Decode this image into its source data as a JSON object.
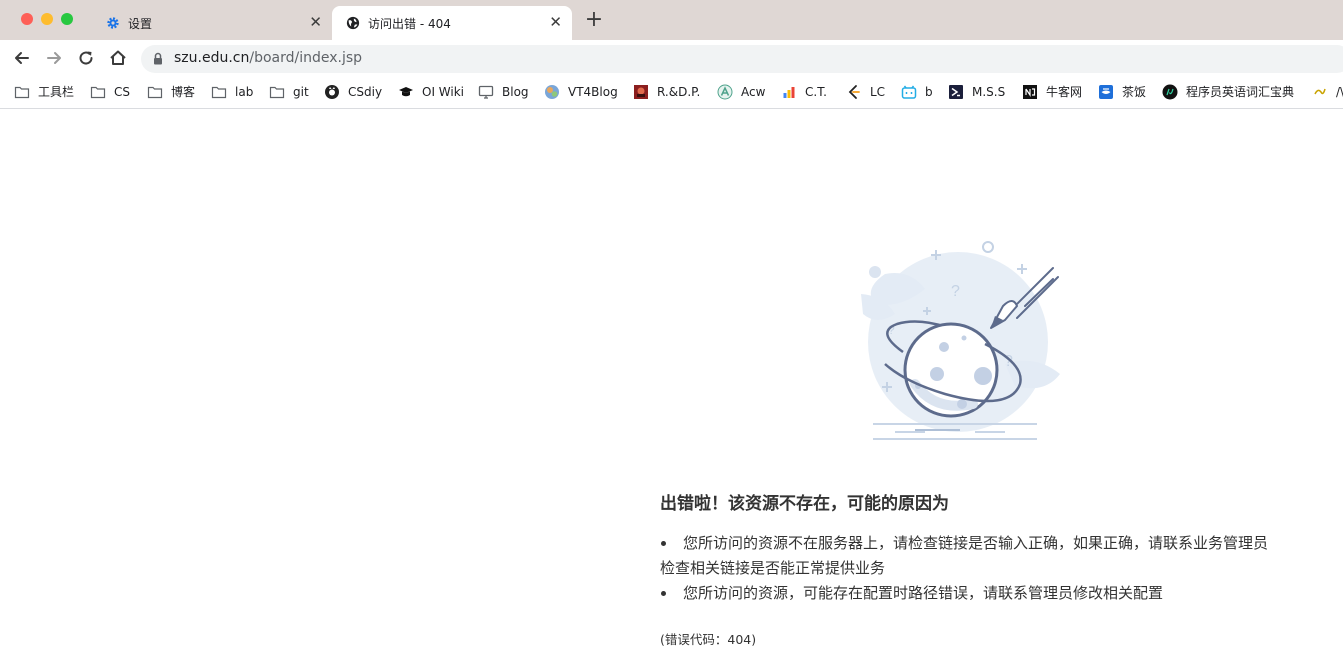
{
  "browser": {
    "tabs": [
      {
        "title": "设置",
        "icon": "gear-icon",
        "active": false
      },
      {
        "title": "访问出错 - 404",
        "icon": "globe-icon",
        "active": true
      }
    ],
    "url": {
      "host": "szu.edu.cn",
      "path": "/board/index.jsp"
    },
    "bookmarks": [
      {
        "label": "工具栏",
        "icon": "folder-icon"
      },
      {
        "label": "CS",
        "icon": "folder-icon"
      },
      {
        "label": "博客",
        "icon": "folder-icon"
      },
      {
        "label": "lab",
        "icon": "folder-icon"
      },
      {
        "label": "git",
        "icon": "folder-icon"
      },
      {
        "label": "CSdiy",
        "icon": "csdiy-icon"
      },
      {
        "label": "OI Wiki",
        "icon": "graduation-cap-icon"
      },
      {
        "label": "Blog",
        "icon": "monitor-icon"
      },
      {
        "label": "VT4Blog",
        "icon": "vt4blog-icon"
      },
      {
        "label": "R.&D.P.",
        "icon": "rdp-icon"
      },
      {
        "label": "Acw",
        "icon": "acw-icon"
      },
      {
        "label": "C.T.",
        "icon": "bar-chart-icon"
      },
      {
        "label": "LC",
        "icon": "leetcode-icon"
      },
      {
        "label": "b",
        "icon": "bilibili-icon"
      },
      {
        "label": "M.S.S",
        "icon": "mss-icon"
      },
      {
        "label": "牛客网",
        "icon": "nowcoder-icon"
      },
      {
        "label": "茶饭",
        "icon": "chafan-icon"
      },
      {
        "label": "程序员英语词汇宝典",
        "icon": "dictionary-icon"
      },
      {
        "label": "/\\",
        "icon": "overflow-icon"
      }
    ]
  },
  "page": {
    "title": "出错啦！该资源不存在，可能的原因为",
    "reasons": [
      "您所访问的资源不在服务器上，请检查链接是否输入正确，如果正确，请联系业务管理员检查相关链接是否能正常提供业务",
      "您所访问的资源，可能存在配置时路径错误，请联系管理员修改相关配置"
    ],
    "error_code": "(错误代码：404)"
  },
  "colors": {
    "tab_strip": "#dfd7d4",
    "omnibox": "#f1f3f4",
    "illustration_stroke": "#5d6b8c",
    "illustration_fill": "#e3ebf5"
  }
}
